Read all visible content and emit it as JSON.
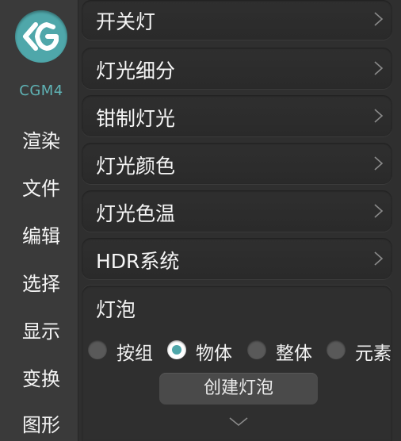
{
  "app": {
    "brand": "CGM4",
    "logo_icon": "cgm-logo-icon",
    "accent": "#4fa7aa"
  },
  "sidebar": {
    "items": [
      {
        "label": "渲染"
      },
      {
        "label": "文件"
      },
      {
        "label": "编辑"
      },
      {
        "label": "选择"
      },
      {
        "label": "显示"
      },
      {
        "label": "变换"
      },
      {
        "label": "图形"
      }
    ]
  },
  "main": {
    "rows": [
      {
        "label": "开关灯",
        "icon": "chevron-right-icon"
      },
      {
        "label": "灯光细分",
        "icon": "chevron-right-icon"
      },
      {
        "label": "钳制灯光",
        "icon": "chevron-right-icon"
      },
      {
        "label": "灯光颜色",
        "icon": "chevron-right-icon"
      },
      {
        "label": "灯光色温",
        "icon": "chevron-right-icon"
      },
      {
        "label": "HDR系统",
        "icon": "chevron-right-icon"
      }
    ],
    "bulb": {
      "title": "灯泡",
      "options": [
        {
          "label": "按组",
          "selected": false
        },
        {
          "label": "物体",
          "selected": true
        },
        {
          "label": "整体",
          "selected": false
        },
        {
          "label": "元素",
          "selected": false
        }
      ],
      "create_button": "创建灯泡",
      "expand_icon": "chevron-down-icon"
    }
  }
}
